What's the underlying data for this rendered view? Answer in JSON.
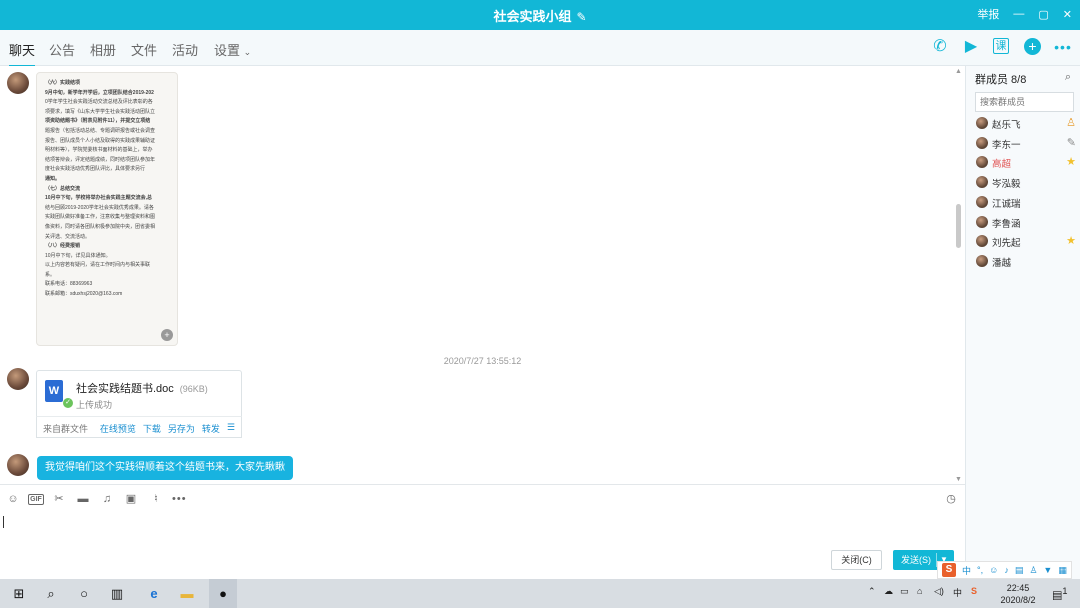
{
  "window": {
    "title": "社会实践小组",
    "controls": [
      "举报",
      "—",
      "▢",
      "✕"
    ]
  },
  "tabs": [
    "聊天",
    "公告",
    "相册",
    "文件",
    "活动",
    "设置"
  ],
  "toolbar_icons": [
    "phone-icon",
    "video-icon",
    "course-icon",
    "add-icon",
    "more-icon"
  ],
  "chat": {
    "doc_lines": [
      {
        "t": "（六）实践结项",
        "b": true
      },
      {
        "t": "9月中旬，新学年开学后，立项团队结合2019-202",
        "b": true
      },
      {
        "t": "0学年学生社会实践活动交流总结及评比表彰的各",
        "b": false
      },
      {
        "t": "项要求，填写《山东大学学生社会实践活动团队立",
        "b": false
      },
      {
        "t": "项资助结题书》（附表见附件11），并提交立项结",
        "b": true
      },
      {
        "t": "题报告（包括活动总结、专题调研报告或社会调查",
        "b": false
      },
      {
        "t": "报告、团队成员个人小结及取得的实践成果辅助证",
        "b": false
      },
      {
        "t": "明材料等），学院党委核书面材料的基础上，举办",
        "b": false
      },
      {
        "t": "结项答辩会，评定结题成绩，同时结项团队参加年",
        "b": false
      },
      {
        "t": "度社会实践活动优秀团队评比，具体要求另行",
        "b": false
      },
      {
        "t": "通知。",
        "b": true
      },
      {
        "t": "（七）总结交流",
        "b": true
      },
      {
        "t": "10月中下旬，学校将举办社会实践主题交流会,总",
        "b": true
      },
      {
        "t": "结与回顾2019-2020学年社会实践优秀成果。请各",
        "b": false
      },
      {
        "t": "实践团队做好准备工作，注意收集与整理资料和图",
        "b": false
      },
      {
        "t": "像资料，同时请各团队积极参加院中央，团省委相",
        "b": false
      },
      {
        "t": "关评选、交流活动。",
        "b": false
      },
      {
        "t": "（八）经费报销",
        "b": true
      },
      {
        "t": "10月中下旬，详见具体通知。",
        "b": false
      },
      {
        "t": "",
        "b": false
      },
      {
        "t": "以上内容若有疑问，请在工作时间内与相关事联",
        "b": false
      },
      {
        "t": "系。",
        "b": false
      },
      {
        "t": "联系电话：88369963",
        "b": false
      },
      {
        "t": "联系邮箱：sduxhsj2020@163.com",
        "b": false
      }
    ],
    "timestamp": "2020/7/27 13:55:12",
    "file": {
      "name": "社会实践结题书.doc",
      "size": "(96KB)",
      "status": "上传成功",
      "source": "来自群文件",
      "actions": [
        "在线预览",
        "下载",
        "另存为",
        "转发"
      ]
    },
    "message": "我觉得咱们这个实践得顺着这个结题书来，大家先瞅瞅"
  },
  "buttons": {
    "close": "关闭(C)",
    "send": "发送(S)"
  },
  "members": {
    "title": "群成员 8/8",
    "search_placeholder": "搜索群成员",
    "list": [
      {
        "name": "赵乐飞",
        "badge": "owner-icon",
        "red": false
      },
      {
        "name": "李东一",
        "badge": "edit-icon",
        "red": false
      },
      {
        "name": "高超",
        "badge": "star-icon",
        "red": true
      },
      {
        "name": "岑泓毅",
        "badge": "",
        "red": false
      },
      {
        "name": "江诚瑞",
        "badge": "",
        "red": false
      },
      {
        "name": "李鲁涵",
        "badge": "",
        "red": false
      },
      {
        "name": "刘先起",
        "badge": "star-icon",
        "red": false
      },
      {
        "name": "潘越",
        "badge": "",
        "red": false
      }
    ]
  },
  "taskbar": {
    "time": "22:45",
    "date": "2020/8/2",
    "ime_label": "中",
    "notif_count": "1"
  },
  "colors": {
    "accent": "#12b7d6",
    "bubble": "#18b3e0",
    "link": "#1a8fd0",
    "owner_red": "#e05252"
  }
}
